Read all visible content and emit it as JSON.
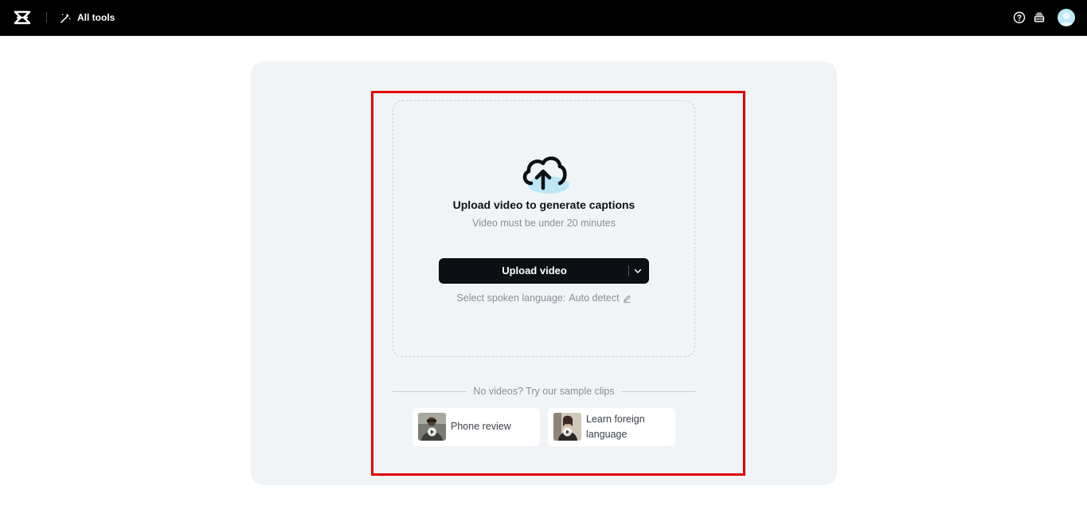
{
  "topbar": {
    "logo_icon": "capcut-logo-icon",
    "all_tools_label": "All tools",
    "help_icon": "help-circle-icon",
    "layers_icon": "layers-icon",
    "avatar_icon": "user-avatar"
  },
  "upload": {
    "cloud_icon": "cloud-upload-icon",
    "title": "Upload video to generate captions",
    "subtitle": "Video must be under 20 minutes",
    "button_label": "Upload video",
    "dropdown_icon": "chevron-down-icon",
    "language_label": "Select spoken language:",
    "language_value": "Auto detect",
    "edit_icon": "pencil-icon"
  },
  "samples": {
    "heading": "No videos? Try our sample clips",
    "items": [
      {
        "label": "Phone review",
        "thumb_icon": "play-icon"
      },
      {
        "label": "Learn foreign language",
        "thumb_icon": "play-icon"
      }
    ]
  },
  "colors": {
    "topbar_bg": "#000000",
    "card_bg": "#f1f4f7",
    "button_bg": "#0c0f14",
    "highlight": "#e00000",
    "cloud_accent": "#bde7f5"
  }
}
